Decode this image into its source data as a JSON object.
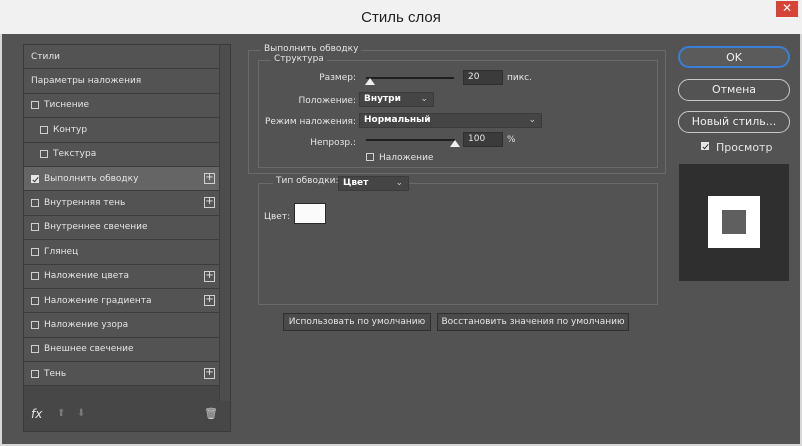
{
  "window": {
    "title": "Стиль слоя",
    "close_glyph": "✕"
  },
  "sidebar": {
    "items": [
      {
        "label": "Стили",
        "checkbox": false,
        "plus": false,
        "sub": false,
        "active": false
      },
      {
        "label": "Параметры наложения",
        "checkbox": false,
        "plus": false,
        "sub": false,
        "active": false
      },
      {
        "label": "Тиснение",
        "checkbox": true,
        "checked": false,
        "plus": false,
        "sub": false,
        "active": false
      },
      {
        "label": "Контур",
        "checkbox": true,
        "checked": false,
        "plus": false,
        "sub": true,
        "active": false
      },
      {
        "label": "Текстура",
        "checkbox": true,
        "checked": false,
        "plus": false,
        "sub": true,
        "active": false
      },
      {
        "label": "Выполнить обводку",
        "checkbox": true,
        "checked": true,
        "plus": true,
        "sub": false,
        "active": true
      },
      {
        "label": "Внутренняя тень",
        "checkbox": true,
        "checked": false,
        "plus": true,
        "sub": false,
        "active": false
      },
      {
        "label": "Внутреннее свечение",
        "checkbox": true,
        "checked": false,
        "plus": false,
        "sub": false,
        "active": false
      },
      {
        "label": "Глянец",
        "checkbox": true,
        "checked": false,
        "plus": false,
        "sub": false,
        "active": false
      },
      {
        "label": "Наложение цвета",
        "checkbox": true,
        "checked": false,
        "plus": true,
        "sub": false,
        "active": false
      },
      {
        "label": "Наложение градиента",
        "checkbox": true,
        "checked": false,
        "plus": true,
        "sub": false,
        "active": false
      },
      {
        "label": "Наложение узора",
        "checkbox": true,
        "checked": false,
        "plus": false,
        "sub": false,
        "active": false
      },
      {
        "label": "Внешнее свечение",
        "checkbox": true,
        "checked": false,
        "plus": false,
        "sub": false,
        "active": false
      },
      {
        "label": "Тень",
        "checkbox": true,
        "checked": false,
        "plus": true,
        "sub": false,
        "active": false
      }
    ],
    "fx_label": "fx",
    "up_glyph": "⬆",
    "down_glyph": "⬇",
    "trash_glyph": "🗑"
  },
  "stroke": {
    "group_title": "Выполнить обводку",
    "structure_title": "Структура",
    "size_label": "Размер:",
    "size_value": "20",
    "size_unit": "пикс.",
    "position_label": "Положение:",
    "position_value": "Внутри",
    "blend_label": "Режим наложения:",
    "blend_value": "Нормальный",
    "opacity_label": "Непрозр.:",
    "opacity_value": "100",
    "opacity_unit": "%",
    "overprint_label": "Наложение",
    "fill_type_label": "Тип обводки:",
    "fill_type_value": "Цвет",
    "color_label": "Цвет:",
    "stroke_color": "#fbfbfb",
    "size_slider_level": 0.05,
    "opacity_slider_level": 1.0
  },
  "buttons": {
    "use_default": "Использовать по умолчанию",
    "reset_default": "Восстановить значения по умолчанию"
  },
  "right": {
    "ok": "OK",
    "cancel": "Отмена",
    "new_style": "Новый стиль...",
    "preview_label": "Просмотр",
    "preview_checked": true
  },
  "colors": {
    "accent": "#3b7fd6",
    "close_red": "#d64337",
    "panel": "#535353"
  }
}
